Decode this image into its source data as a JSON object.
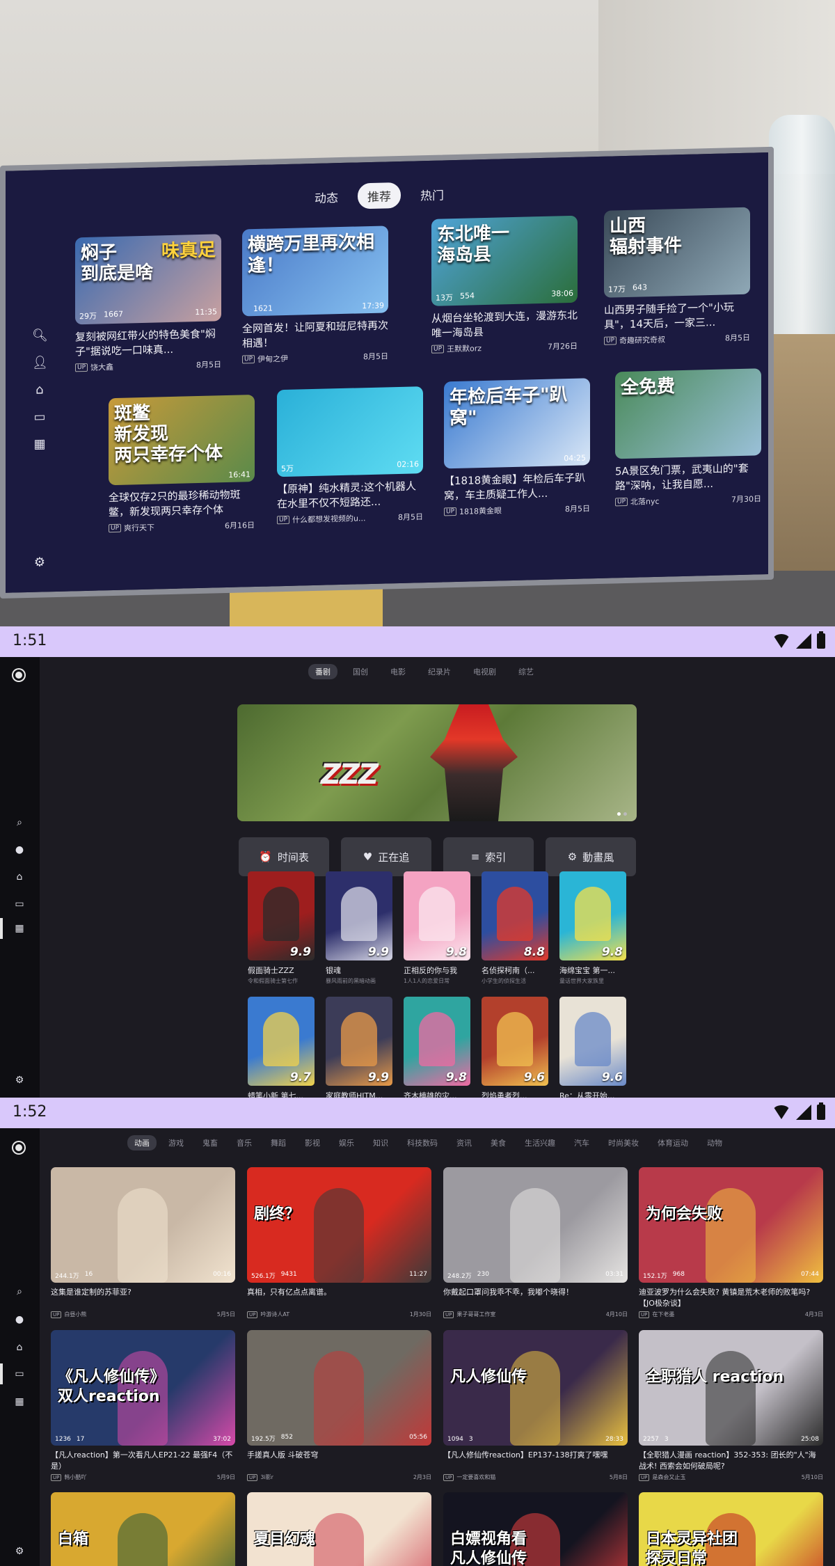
{
  "tv": {
    "tabs": [
      "动态",
      "推荐",
      "热门"
    ],
    "active_tab": 1,
    "cards": [
      {
        "big": "焖子\n到底是啥",
        "tag": "味真足",
        "views": "29万",
        "comments": "1667",
        "duration": "11:35",
        "title": "复刻被网红带火的特色美食\"焖子\"据说吃一口味真...",
        "uploader": "饶大鑫",
        "date": "8月5日"
      },
      {
        "big": "横跨万里再次相逢！",
        "tag": "",
        "views": "",
        "comments": "1621",
        "duration": "17:39",
        "title": "全网首发！让阿夏和班尼特再次相遇！",
        "uploader": "伊甸之伊",
        "date": "8月5日"
      },
      {
        "big": "东北唯一\n海岛县",
        "tag": "",
        "views": "13万",
        "comments": "554",
        "duration": "38:06",
        "title": "从烟台坐轮渡到大连，漫游东北唯一海岛县",
        "uploader": "王默默orz",
        "date": "7月26日"
      },
      {
        "big": "山西\n辐射事件",
        "tag": "",
        "views": "17万",
        "comments": "643",
        "duration": "",
        "title": "山西男子随手捡了一个\"小玩具\"，14天后，一家三...",
        "uploader": "奇趣研究奇叔",
        "date": "8月5日"
      },
      {
        "big": "斑鳖\n新发现\n两只幸存个体",
        "tag": "",
        "views": "",
        "comments": "",
        "duration": "16:41",
        "title": "全球仅存2只的最珍稀动物斑鳖，新发现两只幸存个体",
        "uploader": "爽行天下",
        "date": "6月16日"
      },
      {
        "big": "",
        "tag": "",
        "views": "5万",
        "comments": "",
        "duration": "02:16",
        "title": "【原神】纯水精灵:这个机器人在水里不仅不短路还...",
        "uploader": "什么都想发视频的u...",
        "date": "8月5日"
      },
      {
        "big": "年检后车子\"趴窝\"",
        "tag": "",
        "views": "",
        "comments": "",
        "duration": "04:25",
        "title": "【1818黄金眼】年检后车子趴窝，车主质疑工作人...",
        "uploader": "1818黄金眼",
        "date": "8月5日"
      },
      {
        "big": "全免费",
        "tag": "",
        "views": "",
        "comments": "",
        "duration": "",
        "title": "5A景区免门票，武夷山的\"套路\"深呐，让我自愿...",
        "uploader": "北落nyc",
        "date": "7月30日"
      }
    ]
  },
  "status1": {
    "time": "1:51"
  },
  "status2": {
    "time": "1:52"
  },
  "screen2": {
    "tabs": [
      "番剧",
      "国创",
      "电影",
      "纪录片",
      "电视剧",
      "综艺"
    ],
    "active_tab": 0,
    "banner_logo": "ZZZ",
    "buttons": [
      {
        "icon": "⏰",
        "label": "时间表"
      },
      {
        "icon": "♥",
        "label": "正在追"
      },
      {
        "icon": "≡",
        "label": "索引"
      },
      {
        "icon": "⚙",
        "label": "動畫風"
      }
    ],
    "row1": [
      {
        "title": "假面骑士ZZZ",
        "sub": "令和假面骑士第七作",
        "score": "9.9",
        "bg": "#9e1e1e",
        "fg": "#2b2b2b"
      },
      {
        "title": "银魂",
        "sub": "暴风雨前的黑暗动画",
        "score": "9.9",
        "bg": "#2d2f6b",
        "fg": "#d8d8e6"
      },
      {
        "title": "正相反的你与我",
        "sub": "1人1人的恋爱日常",
        "score": "9.8",
        "bg": "#f4a3c2",
        "fg": "#fbe6ee"
      },
      {
        "title": "名侦探柯南（...",
        "sub": "小学生的侦探生活",
        "score": "8.8",
        "bg": "#2d4ea0",
        "fg": "#e33a2a"
      },
      {
        "title": "海绵宝宝 第一...",
        "sub": "童话世界大家族里",
        "score": "9.8",
        "bg": "#2ab5d6",
        "fg": "#f5e04a"
      }
    ],
    "row2": [
      {
        "title": "蜡笔小新 第七...",
        "sub": "",
        "score": "9.7",
        "bg": "#3a7ad0",
        "fg": "#f1d24c"
      },
      {
        "title": "家庭教师HITM...",
        "sub": "",
        "score": "9.9",
        "bg": "#3c3c58",
        "fg": "#e89a48"
      },
      {
        "title": "齐木楠雄的灾...",
        "sub": "",
        "score": "9.8",
        "bg": "#2fa5a0",
        "fg": "#f06aa2"
      },
      {
        "title": "烈焰勇者烈...",
        "sub": "",
        "score": "9.6",
        "bg": "#b3402c",
        "fg": "#f0c050"
      },
      {
        "title": "Re：从零开始...",
        "sub": "",
        "score": "9.6",
        "bg": "#e8e2d6",
        "fg": "#6a8ac8"
      }
    ]
  },
  "screen3": {
    "tabs": [
      "动画",
      "游戏",
      "鬼畜",
      "音乐",
      "舞蹈",
      "影视",
      "娱乐",
      "知识",
      "科技数码",
      "资讯",
      "美食",
      "生活兴趣",
      "汽车",
      "时尚美妆",
      "体育运动",
      "动物"
    ],
    "active_tab": 0,
    "videos": [
      {
        "big": "",
        "views": "244.1万",
        "comments": "16",
        "duration": "00:16",
        "title": "这集是谁定制的苏菲亚?",
        "uploader": "白昼小熊",
        "date": "5月5日",
        "bg": "#c9b8a6",
        "accent": "#f1e3cf"
      },
      {
        "big": "剧终？",
        "views": "526.1万",
        "comments": "9431",
        "duration": "11:27",
        "title": "真相，只有亿点点离谱。",
        "uploader": "吟游诗人AT",
        "date": "1月30日",
        "bg": "#d82a20",
        "accent": "#3a3a3a"
      },
      {
        "big": "",
        "views": "248.2万",
        "comments": "230",
        "duration": "03:31",
        "title": "你戴起口罩问我乖不乖，我嘟个晓得！",
        "uploader": "果子哥哥工作室",
        "date": "4月10日",
        "bg": "#9c9aa0",
        "accent": "#e6e4e2"
      },
      {
        "big": "为何会失败",
        "views": "152.1万",
        "comments": "968",
        "duration": "07:44",
        "title": "迪亚波罗为什么会失败? 黄镇是荒木老师的败笔吗? 【JO极杂谈】",
        "uploader": "在下老墨",
        "date": "4月3日",
        "bg": "#b83a4a",
        "accent": "#f0c040"
      },
      {
        "big": "《凡人修仙传》\n双人reaction",
        "views": "1236",
        "comments": "17",
        "duration": "37:02",
        "title": "【凡人reaction】第一次看凡人EP21-22 最强F4（不是）",
        "uploader": "韩小酷吖",
        "date": "5月9日",
        "bg": "#263a6a",
        "accent": "#d64aa8"
      },
      {
        "big": "",
        "views": "192.5万",
        "comments": "852",
        "duration": "05:56",
        "title": "手搓真人版 斗破苍穹",
        "uploader": "3i影r",
        "date": "2月3日",
        "bg": "#6f6a62",
        "accent": "#c23838"
      },
      {
        "big": "凡人修仙传",
        "views": "1094",
        "comments": "3",
        "duration": "28:33",
        "title": "【凡人修仙传reaction】EP137-138打爽了嘿嘿",
        "uploader": "一定要喜欢和猫",
        "date": "5月8日",
        "bg": "#3a2a4a",
        "accent": "#e8c040"
      },
      {
        "big": "全职猎人 reaction",
        "views": "2257",
        "comments": "3",
        "duration": "25:08",
        "title": "【全职猎人漫画 reaction】352-353: 团长的\"人\"海战术! 西索会如何破局呢?",
        "uploader": "是森会又止玉",
        "date": "5月10日",
        "bg": "#c4c0c8",
        "accent": "#2a2a2a"
      },
      {
        "big": "白箱",
        "views": "",
        "comments": "",
        "duration": "",
        "title": "",
        "uploader": "",
        "date": "",
        "bg": "#d8a830",
        "accent": "#2a5a3a"
      },
      {
        "big": "夏目幻魂",
        "views": "",
        "comments": "",
        "duration": "",
        "title": "",
        "uploader": "",
        "date": "",
        "bg": "#f2e2d0",
        "accent": "#d04858"
      },
      {
        "big": "白嫖视角看\n凡人修仙传",
        "views": "",
        "comments": "",
        "duration": "",
        "title": "",
        "uploader": "",
        "date": "",
        "bg": "#141420",
        "accent": "#e84040"
      },
      {
        "big": "日本灵异社团\n探灵日常",
        "views": "",
        "comments": "",
        "duration": "",
        "title": "",
        "uploader": "",
        "date": "",
        "bg": "#e8d848",
        "accent": "#c02020"
      }
    ]
  }
}
